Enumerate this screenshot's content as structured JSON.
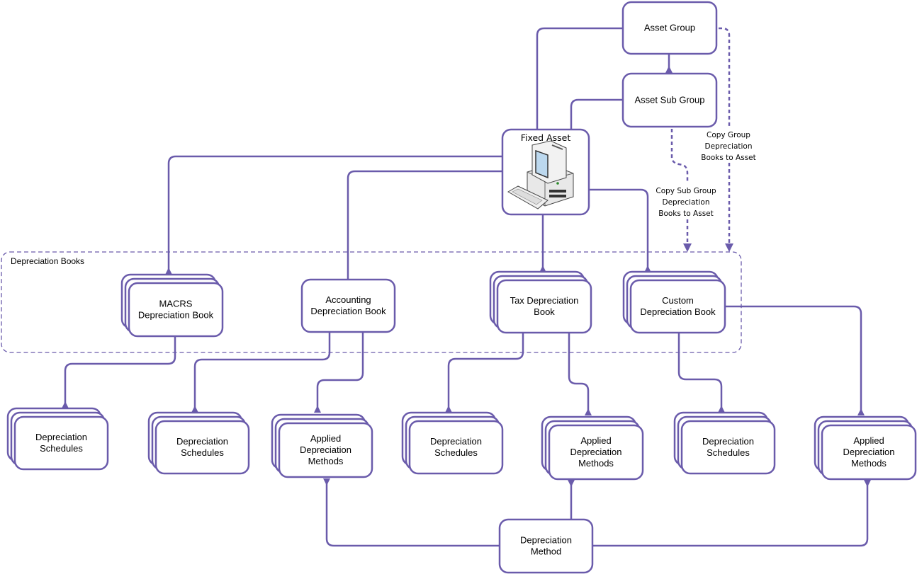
{
  "colors": {
    "stroke": "#6a5bab",
    "fill": "#ffffff",
    "text": "#000000"
  },
  "group": {
    "label": "Depreciation Books"
  },
  "nodes": {
    "asset_group": {
      "lines": [
        "Asset Group"
      ]
    },
    "asset_sub_group": {
      "lines": [
        "Asset Sub Group"
      ]
    },
    "fixed_asset": {
      "lines": [
        "Fixed Asset"
      ],
      "icon": "computer-icon"
    },
    "macrs_book": {
      "lines": [
        "MACRS",
        "Depreciation Book"
      ]
    },
    "accounting_book": {
      "lines": [
        "Accounting",
        "Depreciation Book"
      ]
    },
    "tax_book": {
      "lines": [
        "Tax Depreciation",
        "Book"
      ]
    },
    "custom_book": {
      "lines": [
        "Custom",
        "Depreciation Book"
      ]
    },
    "schedules_1": {
      "lines": [
        "Depreciation",
        "Schedules"
      ]
    },
    "schedules_2": {
      "lines": [
        "Depreciation",
        "Schedules"
      ]
    },
    "methods_1": {
      "lines": [
        "Applied",
        "Depreciation",
        "Methods"
      ]
    },
    "schedules_3": {
      "lines": [
        "Depreciation",
        "Schedules"
      ]
    },
    "methods_2": {
      "lines": [
        "Applied",
        "Depreciation",
        "Methods"
      ]
    },
    "schedules_4": {
      "lines": [
        "Depreciation",
        "Schedules"
      ]
    },
    "methods_3": {
      "lines": [
        "Applied",
        "Depreciation",
        "Methods"
      ]
    },
    "depreciation_method": {
      "lines": [
        "Depreciation",
        "Method"
      ]
    }
  },
  "annotations": {
    "copy_group": {
      "lines": [
        "Copy Group",
        "Depreciation",
        "Books to Asset"
      ]
    },
    "copy_sub_group": {
      "lines": [
        "Copy Sub Group",
        "Depreciation",
        "Books to Asset"
      ]
    }
  }
}
